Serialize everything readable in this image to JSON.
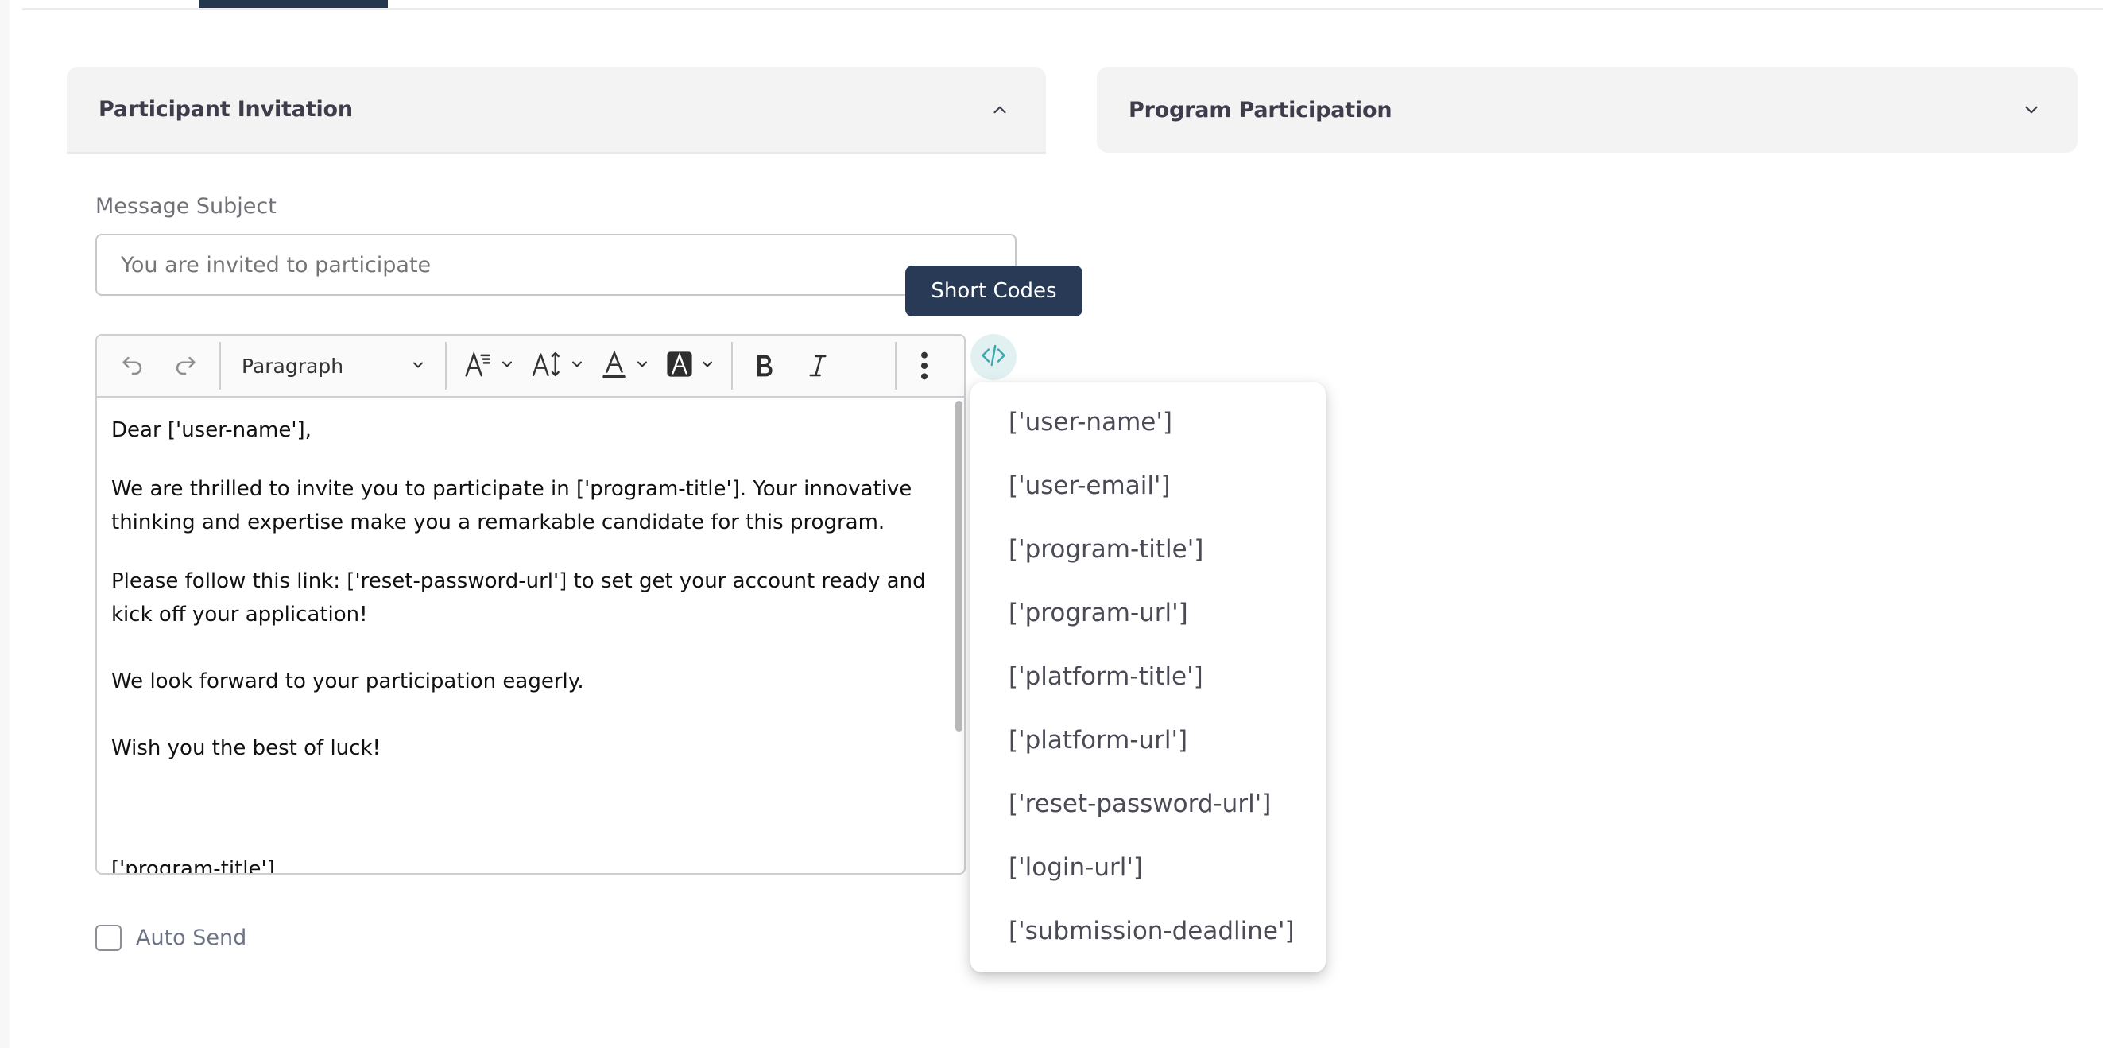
{
  "tabs": {
    "active_indicator_color": "#25374f"
  },
  "accordions": [
    {
      "title": "Participant Invitation",
      "state": "expanded",
      "icon": "chevron-up-icon"
    },
    {
      "title": "Program Participation",
      "state": "collapsed",
      "icon": "chevron-down-icon"
    }
  ],
  "form": {
    "subject_label": "Message Subject",
    "subject_value": "",
    "subject_placeholder": "You are invited to participate",
    "auto_send_label": "Auto Send",
    "auto_send_checked": false
  },
  "tooltip": {
    "text": "Short Codes"
  },
  "editor": {
    "toolbar": {
      "undo": "undo-icon",
      "redo": "redo-icon",
      "block_format": "Paragraph",
      "font_family": "font-family-icon",
      "font_size": "font-size-icon",
      "font_color": "font-color-icon",
      "highlight": "font-background-icon",
      "bold": "bold-icon",
      "italic": "italic-icon",
      "more": "more-vertical-icon"
    },
    "paragraphs": [
      "Dear ['user-name'],",
      "We are thrilled to invite you to participate in ['program-title']. Your innovative thinking and expertise make you a remarkable candidate for this program.",
      "Please follow this link: ['reset-password-url'] to set get your account ready and kick off your application!",
      "We look forward to your participation eagerly.",
      "Wish you the best of luck!",
      "['program-title']"
    ]
  },
  "short_codes": {
    "button_icon": "code-icon",
    "accent_color": "#3aa8ad",
    "items": [
      "['user-name']",
      "['user-email']",
      "['program-title']",
      "['program-url']",
      "['platform-title']",
      "['platform-url']",
      "['reset-password-url']",
      "['login-url']",
      "['submission-deadline']"
    ]
  }
}
